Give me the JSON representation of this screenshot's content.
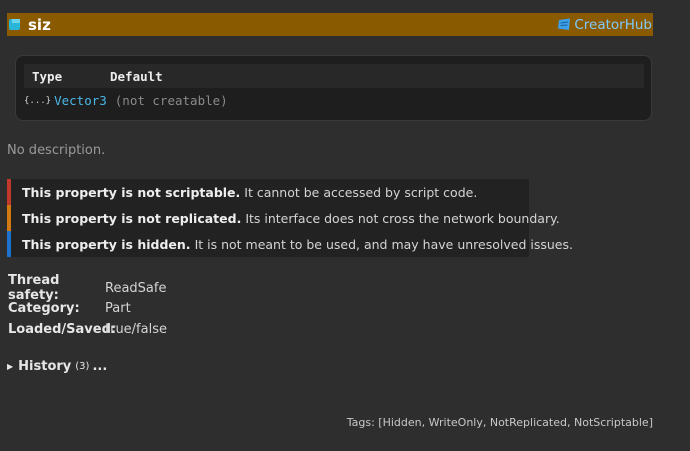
{
  "header": {
    "title": "siz",
    "creatorhub_label": "CreatorHub",
    "bar_color": "#8a5a00"
  },
  "type_table": {
    "col_type": "Type",
    "col_default": "Default",
    "type_icon": "{...}",
    "type_name": "Vector3",
    "default_value": "(not creatable)"
  },
  "description": "No description.",
  "warnings": [
    {
      "title": "This property is not scriptable.",
      "text": "It cannot be accessed by script code.",
      "color": "#c0392b"
    },
    {
      "title": "This property is not replicated.",
      "text": "Its interface does not cross the network boundary.",
      "color": "#d07a10"
    },
    {
      "title": "This property is hidden.",
      "text": "It is not meant to be used, and may have unresolved issues.",
      "color": "#1d72d0"
    }
  ],
  "meta": [
    {
      "key": "Thread safety:",
      "value": "ReadSafe"
    },
    {
      "key": "Category:",
      "value": "Part"
    },
    {
      "key": "Loaded/Saved:",
      "value": "true/false"
    }
  ],
  "history": {
    "toggle_icon": "▶",
    "label": "History",
    "count": "(3)",
    "ellipsis": "..."
  },
  "tags": "Tags: [Hidden, WriteOnly, NotReplicated, NotScriptable]"
}
